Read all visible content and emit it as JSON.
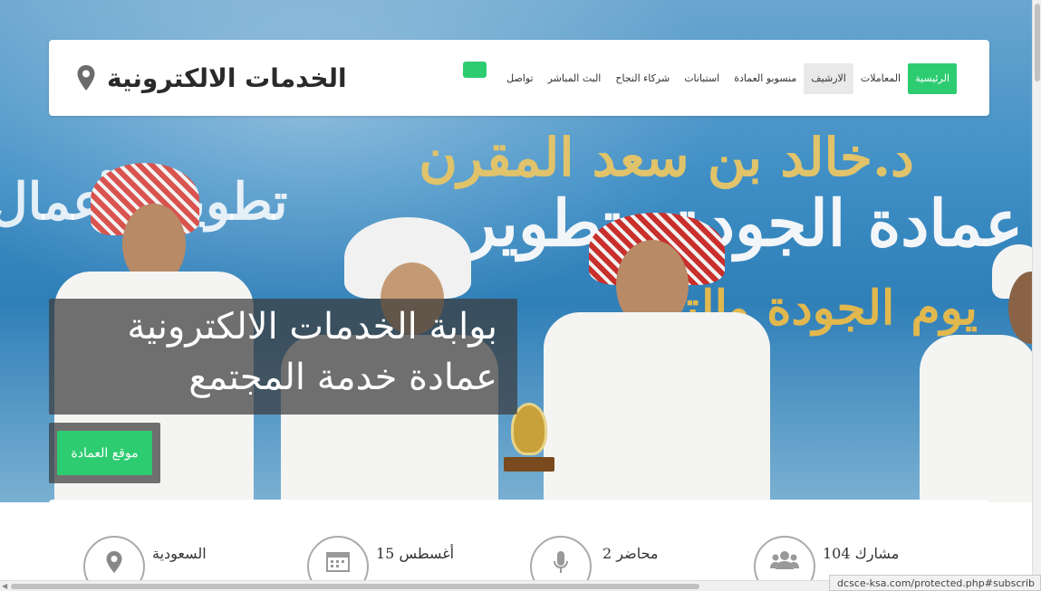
{
  "header": {
    "brand_title": "الخدمات الالكترونية",
    "brand_icon": "map-marker-icon",
    "nav_items": [
      {
        "label": "الرئيسية",
        "state": "active"
      },
      {
        "label": "المعاملات",
        "state": "normal"
      },
      {
        "label": "الارشيف",
        "state": "hover"
      },
      {
        "label": "منسوبو العمادة",
        "state": "normal"
      },
      {
        "label": "استبانات",
        "state": "normal"
      },
      {
        "label": "شركاء النجاح",
        "state": "normal"
      },
      {
        "label": "البث المباشر",
        "state": "normal"
      },
      {
        "label": "تواصل",
        "state": "normal"
      }
    ]
  },
  "hero": {
    "banner_line1": "د.خالد بن سعد المقرن",
    "banner_line2": "عمادة الجودة وتطوير",
    "banner_line3": "يوم الجودة والتميز",
    "banner_ghost": "تطوير الأعمال",
    "caption_line1": "بوابة الخدمات الالكترونية",
    "caption_line2": "عمادة خدمة المجتمع",
    "cta_label": "موقع العمادة"
  },
  "stats": [
    {
      "label": "السعودية",
      "icon": "location-pin-icon"
    },
    {
      "label": "أغسطس 15",
      "icon": "calendar-icon"
    },
    {
      "label": "محاضر 2",
      "icon": "microphone-icon"
    },
    {
      "label": "مشارك 104",
      "icon": "users-icon"
    }
  ],
  "status_bar": {
    "url": "dcsce-ksa.com/protected.php#subscrib"
  },
  "colors": {
    "accent_green": "#2ecc71",
    "overlay": "#3c3c3c"
  }
}
